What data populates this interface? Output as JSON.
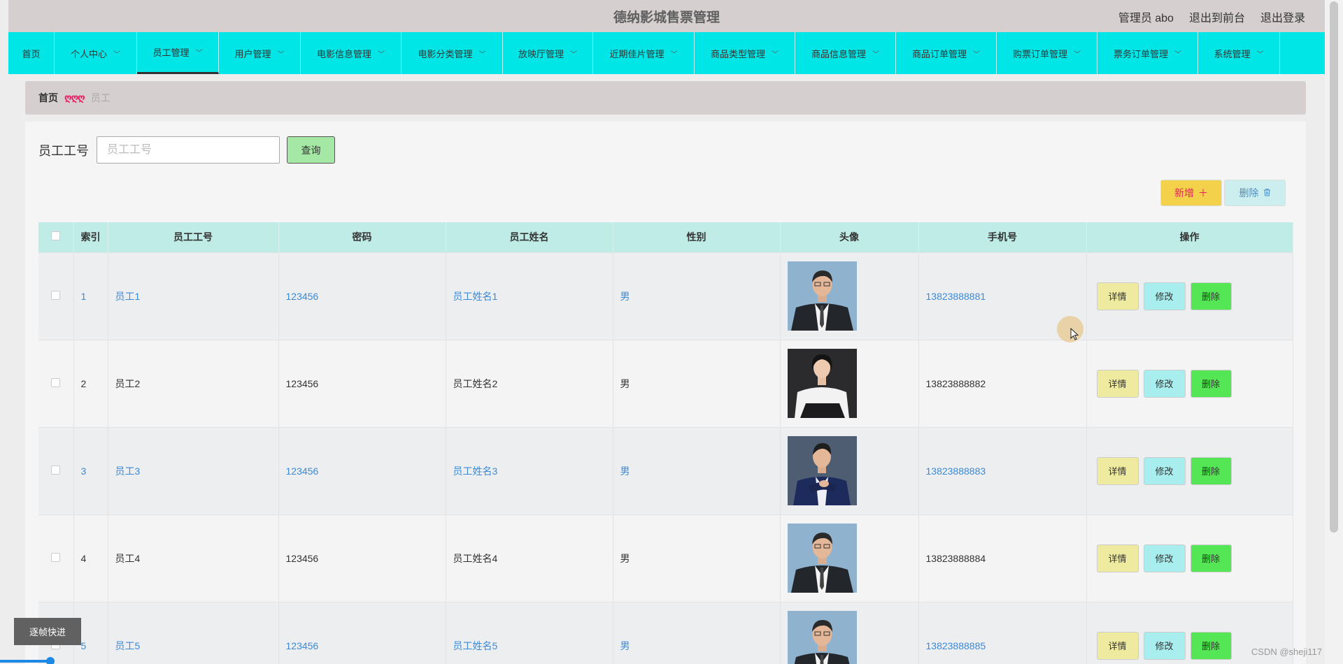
{
  "header": {
    "title": "德纳影城售票管理",
    "user_label": "管理员 abo",
    "front_link": "退出到前台",
    "logout_link": "退出登录"
  },
  "nav": {
    "items": [
      {
        "label": "首页",
        "dropdown": false
      },
      {
        "label": "个人中心",
        "dropdown": true
      },
      {
        "label": "员工管理",
        "dropdown": true,
        "active": true
      },
      {
        "label": "用户管理",
        "dropdown": true
      },
      {
        "label": "电影信息管理",
        "dropdown": true
      },
      {
        "label": "电影分类管理",
        "dropdown": true
      },
      {
        "label": "放映厅管理",
        "dropdown": true
      },
      {
        "label": "近期佳片管理",
        "dropdown": true
      },
      {
        "label": "商品类型管理",
        "dropdown": true
      },
      {
        "label": "商品信息管理",
        "dropdown": true
      },
      {
        "label": "商品订单管理",
        "dropdown": true
      },
      {
        "label": "购票订单管理",
        "dropdown": true
      },
      {
        "label": "票务订单管理",
        "dropdown": true
      },
      {
        "label": "系统管理",
        "dropdown": true
      }
    ]
  },
  "breadcrumb": {
    "home": "首页",
    "separator": "ღღღ",
    "current": "员工"
  },
  "search": {
    "label": "员工工号",
    "placeholder": "员工工号",
    "value": "",
    "button": "查询"
  },
  "actions": {
    "add": "新增",
    "add_icon": "plus-icon",
    "delete": "删除",
    "delete_icon": "trash-icon"
  },
  "table": {
    "columns": [
      "索引",
      "员工工号",
      "密码",
      "员工姓名",
      "性别",
      "头像",
      "手机号",
      "操作"
    ],
    "rows": [
      {
        "index": "1",
        "id": "员工1",
        "password": "123456",
        "name": "员工姓名1",
        "gender": "男",
        "phone": "13823888881",
        "avatar": "man-dark-suit",
        "link": true
      },
      {
        "index": "2",
        "id": "员工2",
        "password": "123456",
        "name": "员工姓名2",
        "gender": "男",
        "phone": "13823888882",
        "avatar": "woman-white-blouse",
        "link": false
      },
      {
        "index": "3",
        "id": "员工3",
        "password": "123456",
        "name": "员工姓名3",
        "gender": "男",
        "phone": "13823888883",
        "avatar": "man-blue-suit",
        "link": true
      },
      {
        "index": "4",
        "id": "员工4",
        "password": "123456",
        "name": "员工姓名4",
        "gender": "男",
        "phone": "13823888884",
        "avatar": "man-dark-suit",
        "link": false
      },
      {
        "index": "5",
        "id": "员工5",
        "password": "123456",
        "name": "员工姓名5",
        "gender": "男",
        "phone": "13823888885",
        "avatar": "man-dark-suit",
        "link": true
      }
    ],
    "row_actions": {
      "detail": "详情",
      "edit": "修改",
      "remove": "删除"
    }
  },
  "overlay": {
    "tooltip": "逐帧快进",
    "watermark": "CSDN @sheji117"
  },
  "colors": {
    "nav_bg": "#00e6e6",
    "header_bg": "#d5cfcf",
    "table_header_bg": "#bfece6",
    "link_text": "#3b8ad8",
    "add_button": "#f3d14a",
    "detail_button": "#eeeaa0",
    "edit_button": "#a8eeee",
    "remove_button": "#55e655"
  }
}
